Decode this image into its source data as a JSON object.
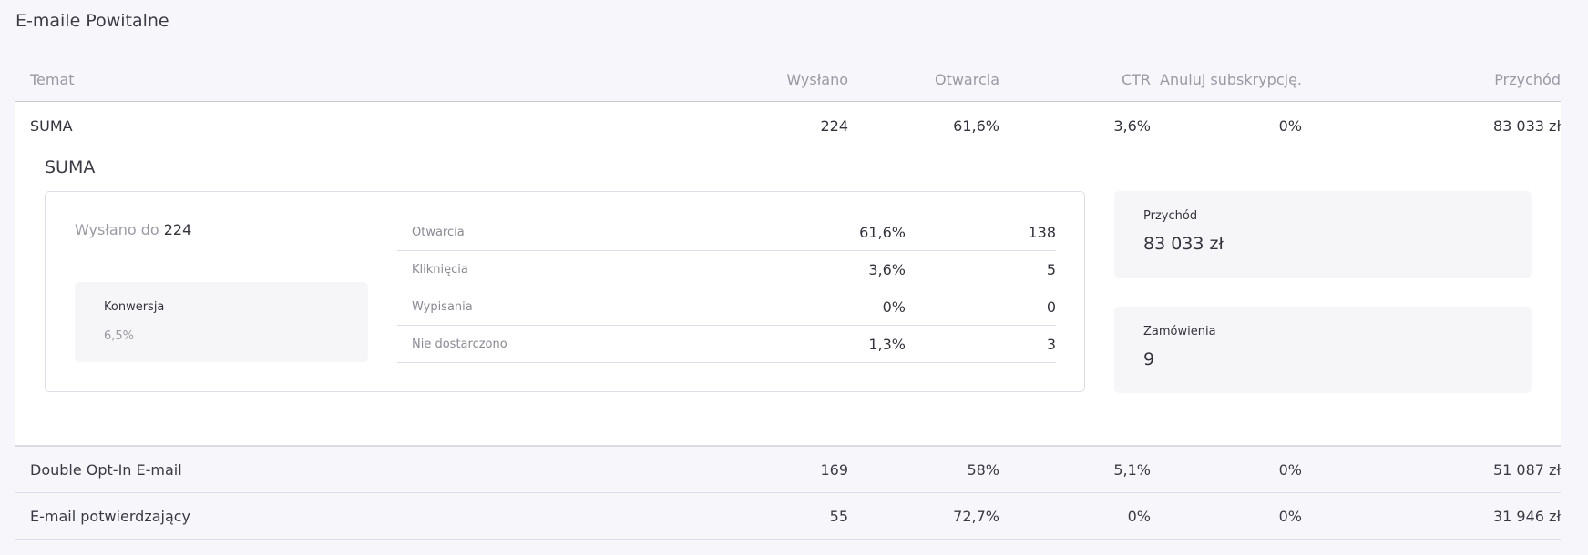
{
  "page": {
    "title": "E-maile Powitalne"
  },
  "table": {
    "headers": [
      "Temat",
      "Wysłano",
      "Otwarcia",
      "CTR",
      "Anuluj subskrypcję.",
      "Przychód"
    ],
    "sum_row": [
      "SUMA",
      "224",
      "61,6%",
      "3,6%",
      "0%",
      "83 033 zł"
    ],
    "rows": [
      [
        "Double Opt-In E-mail",
        "169",
        "58%",
        "5,1%",
        "0%",
        "51 087 zł"
      ],
      [
        "E-mail potwierdzający",
        "55",
        "72,7%",
        "0%",
        "0%",
        "31 946 zł"
      ]
    ]
  },
  "detail": {
    "title": "SUMA",
    "sent_prefix": "Wysłano do",
    "sent_value": "224",
    "conversion": {
      "label": "Konwersja",
      "value": "6,5%"
    },
    "metrics": [
      {
        "label": "Otwarcia",
        "pct": "61,6%",
        "count": "138"
      },
      {
        "label": "Kliknięcia",
        "pct": "3,6%",
        "count": "5"
      },
      {
        "label": "Wypisania",
        "pct": "0%",
        "count": "0"
      },
      {
        "label": "Nie dostarczono",
        "pct": "1,3%",
        "count": "3"
      }
    ],
    "revenue": {
      "label": "Przychód",
      "value": "83 033 zł"
    },
    "orders": {
      "label": "Zamówienia",
      "value": "9"
    }
  }
}
